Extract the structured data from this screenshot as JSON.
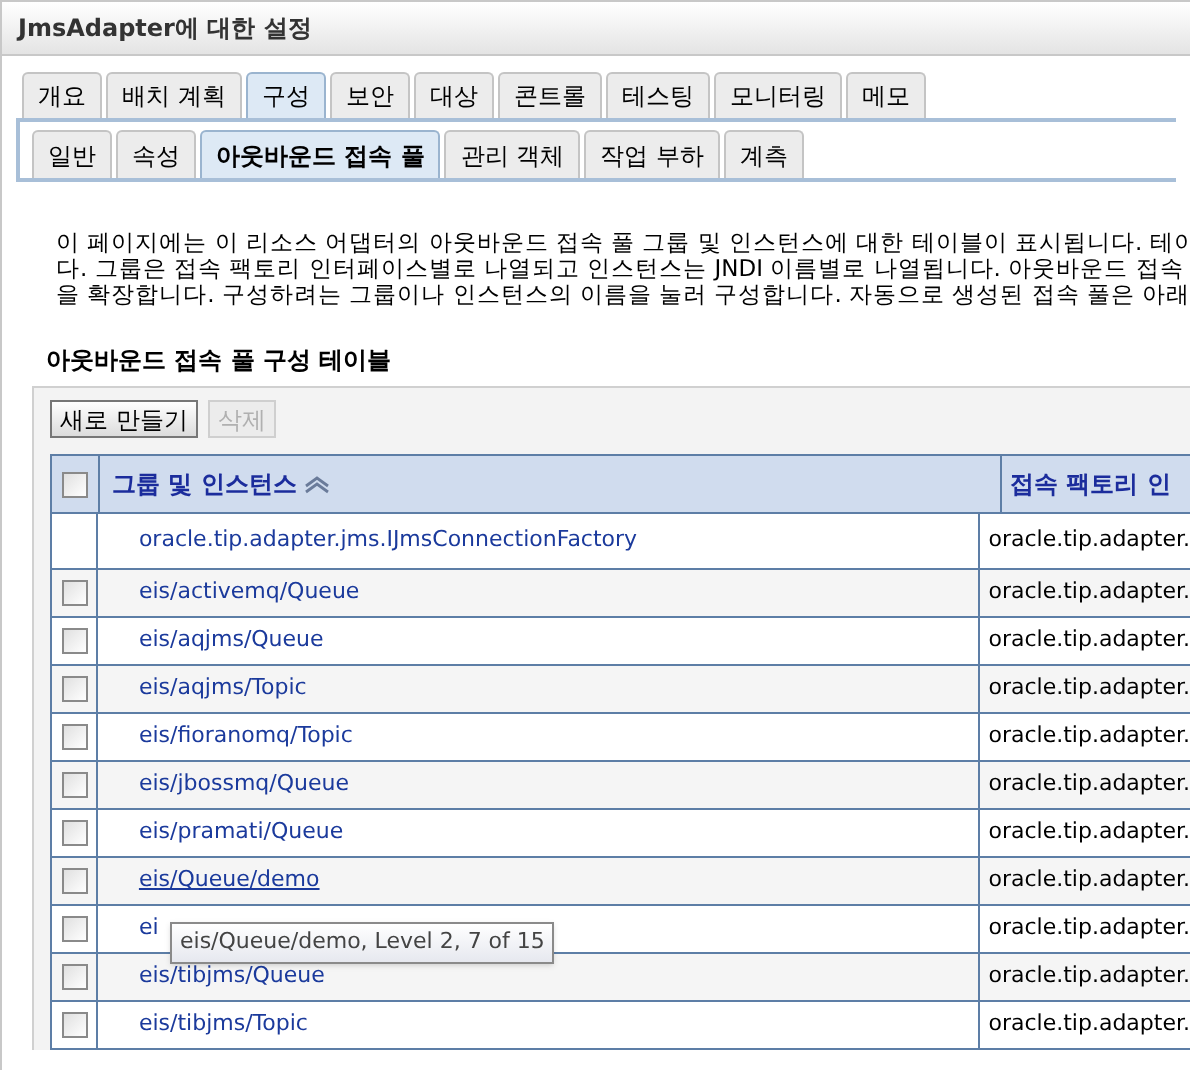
{
  "window": {
    "title": "JmsAdapter에 대한 설정"
  },
  "tabs": [
    {
      "label": "개요",
      "selected": false
    },
    {
      "label": "배치 계획",
      "selected": false
    },
    {
      "label": "구성",
      "selected": true
    },
    {
      "label": "보안",
      "selected": false
    },
    {
      "label": "대상",
      "selected": false
    },
    {
      "label": "콘트롤",
      "selected": false
    },
    {
      "label": "테스팅",
      "selected": false
    },
    {
      "label": "모니터링",
      "selected": false
    },
    {
      "label": "메모",
      "selected": false
    }
  ],
  "subtabs": [
    {
      "label": "일반",
      "selected": false
    },
    {
      "label": "속성",
      "selected": false
    },
    {
      "label": "아웃바운드 접속 풀",
      "selected": true
    },
    {
      "label": "관리 객체",
      "selected": false
    },
    {
      "label": "작업 부하",
      "selected": false
    },
    {
      "label": "계측",
      "selected": false
    }
  ],
  "description_lines": [
    "이 페이지에는 이 리소스 어댑터의 아웃바운드 접속 풀 그룹 및 인스턴스에 대한 테이블이 표시됩니다. 테이",
    "다. 그룹은 접속 팩토리 인터페이스별로 나열되고 인스턴스는 JNDI 이름별로 나열됩니다. 아웃바운드 접속 ",
    "을 확장합니다. 구성하려는 그룹이나 인스턴스의 이름을 눌러 구성합니다. 자동으로 생성된 접속 풀은 아래 "
  ],
  "table": {
    "title": "아웃바운드 접속 풀 구성 테이블",
    "buttons": [
      {
        "label": "새로 만들기",
        "disabled": false
      },
      {
        "label": "삭제",
        "disabled": true
      }
    ],
    "select_all_checked": false,
    "columns": [
      "그룹 및 인스턴스",
      "접속 팩토리 인"
    ],
    "rows": [
      {
        "kind": "group",
        "name": "oracle.tip.adapter.jms.IJmsConnectionFactory",
        "factory": "oracle.tip.adapter.",
        "hover": false
      },
      {
        "kind": "instance",
        "checked": false,
        "name": "eis/activemq/Queue",
        "factory": "oracle.tip.adapter.",
        "hover": false
      },
      {
        "kind": "instance",
        "checked": false,
        "name": "eis/aqjms/Queue",
        "factory": "oracle.tip.adapter.",
        "hover": false
      },
      {
        "kind": "instance",
        "checked": false,
        "name": "eis/aqjms/Topic",
        "factory": "oracle.tip.adapter.",
        "hover": false
      },
      {
        "kind": "instance",
        "checked": false,
        "name": "eis/fioranomq/Topic",
        "factory": "oracle.tip.adapter.",
        "hover": false
      },
      {
        "kind": "instance",
        "checked": false,
        "name": "eis/jbossmq/Queue",
        "factory": "oracle.tip.adapter.",
        "hover": false
      },
      {
        "kind": "instance",
        "checked": false,
        "name": "eis/pramati/Queue",
        "factory": "oracle.tip.adapter.",
        "hover": false
      },
      {
        "kind": "instance",
        "checked": false,
        "name": "eis/Queue/demo",
        "factory": "oracle.tip.adapter.",
        "hover": true
      },
      {
        "kind": "instance",
        "checked": false,
        "name": "ei",
        "factory": "oracle.tip.adapter.",
        "hover": false
      },
      {
        "kind": "instance",
        "checked": false,
        "name": "eis/tibjms/Queue",
        "factory": "oracle.tip.adapter.",
        "hover": false
      },
      {
        "kind": "instance",
        "checked": false,
        "name": "eis/tibjms/Topic",
        "factory": "oracle.tip.adapter.",
        "hover": false
      }
    ]
  },
  "tooltip": {
    "text": "eis/Queue/demo, Level 2, 7 of 15"
  }
}
